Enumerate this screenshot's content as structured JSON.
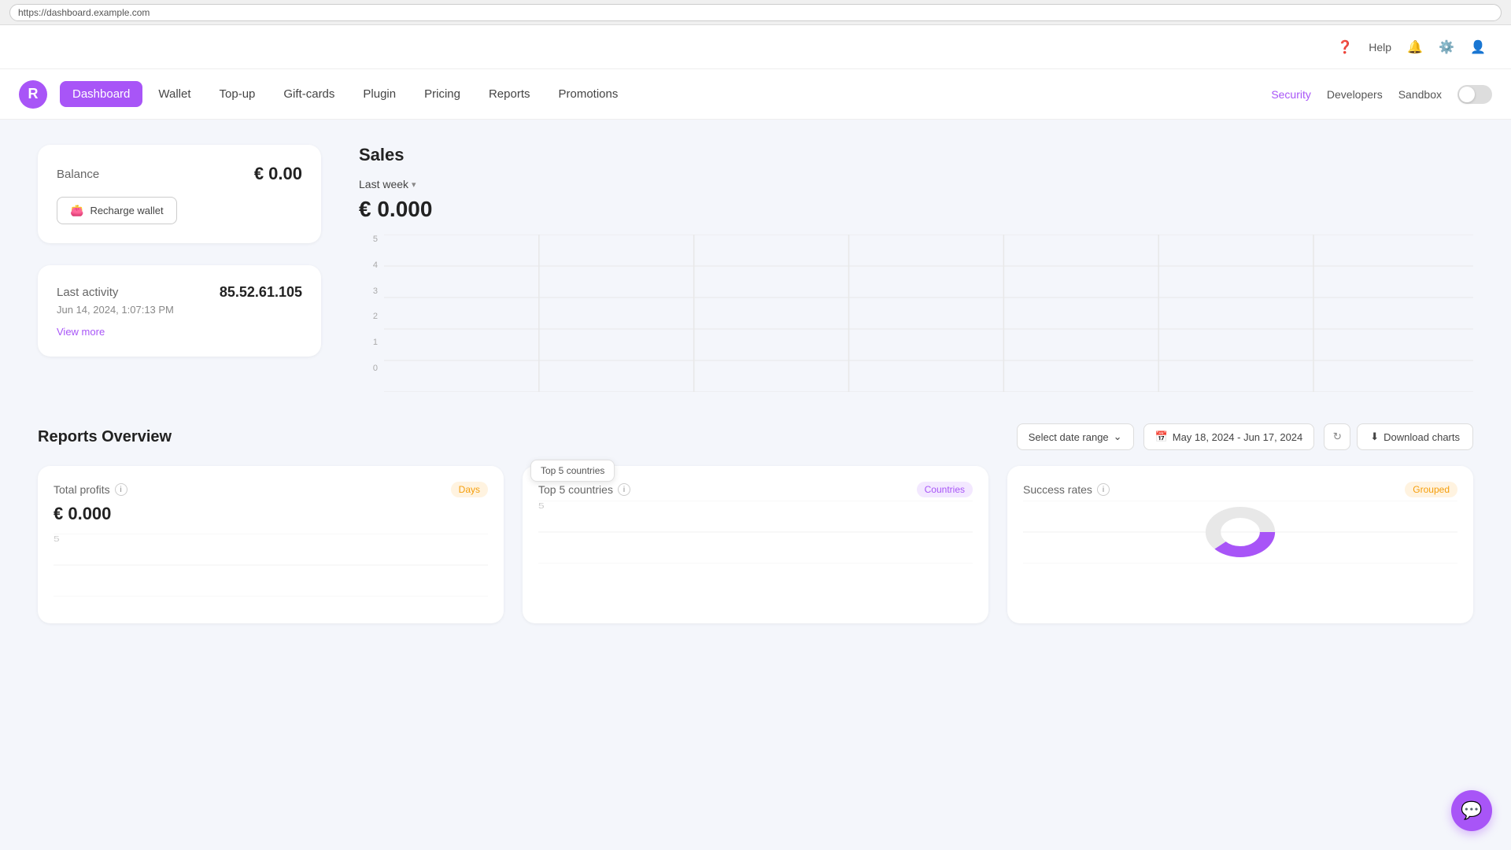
{
  "browser": {
    "url": "https://dashboard.example.com"
  },
  "utility_bar": {
    "help_label": "Help",
    "bell_label": "Notifications",
    "settings_label": "Settings",
    "user_label": "User"
  },
  "navbar": {
    "logo_letter": "R",
    "active_nav": "Dashboard",
    "nav_items": [
      {
        "id": "dashboard",
        "label": "Dashboard",
        "active": true
      },
      {
        "id": "wallet",
        "label": "Wallet",
        "active": false
      },
      {
        "id": "topup",
        "label": "Top-up",
        "active": false
      },
      {
        "id": "giftcards",
        "label": "Gift-cards",
        "active": false
      },
      {
        "id": "plugin",
        "label": "Plugin",
        "active": false
      },
      {
        "id": "pricing",
        "label": "Pricing",
        "active": false
      },
      {
        "id": "reports",
        "label": "Reports",
        "active": false
      },
      {
        "id": "promotions",
        "label": "Promotions",
        "active": false
      }
    ],
    "right_links": [
      {
        "id": "security",
        "label": "Security",
        "active": true
      },
      {
        "id": "developers",
        "label": "Developers",
        "active": false
      },
      {
        "id": "sandbox",
        "label": "Sandbox",
        "active": false
      }
    ],
    "sandbox_toggle_label": "Sandbox"
  },
  "balance_card": {
    "label": "Balance",
    "value": "€ 0.00",
    "recharge_label": "Recharge wallet"
  },
  "activity_card": {
    "label": "Last activity",
    "ip": "85.52.61.105",
    "date": "Jun 14, 2024, 1:07:13 PM",
    "view_more_label": "View more"
  },
  "sales": {
    "title": "Sales",
    "period_label": "Last week",
    "amount": "€ 0.000",
    "chart": {
      "y_labels": [
        "5",
        "4",
        "3",
        "2",
        "1",
        "0"
      ],
      "bars": [
        0,
        0,
        0,
        0,
        0,
        0,
        0
      ]
    }
  },
  "reports_overview": {
    "title": "Reports Overview",
    "date_range_label": "Select date range",
    "date_range_value": "May 18, 2024 - Jun 17, 2024",
    "download_label": "Download charts",
    "refresh_label": "Refresh",
    "cards": [
      {
        "id": "total-profits",
        "title": "Total profits",
        "badge_label": "Days",
        "badge_type": "orange",
        "value": "€ 0.000"
      },
      {
        "id": "top-5-countries",
        "title": "Top 5 countries",
        "badge_label": "Countries",
        "badge_type": "purple",
        "value": ""
      },
      {
        "id": "success-rates",
        "title": "Success rates",
        "badge_label": "Grouped",
        "badge_type": "orange",
        "value": ""
      }
    ],
    "tooltip_text": "Top 5 countries",
    "chart_y_label_top": "5"
  },
  "chat_fab": {
    "icon": "💬"
  }
}
